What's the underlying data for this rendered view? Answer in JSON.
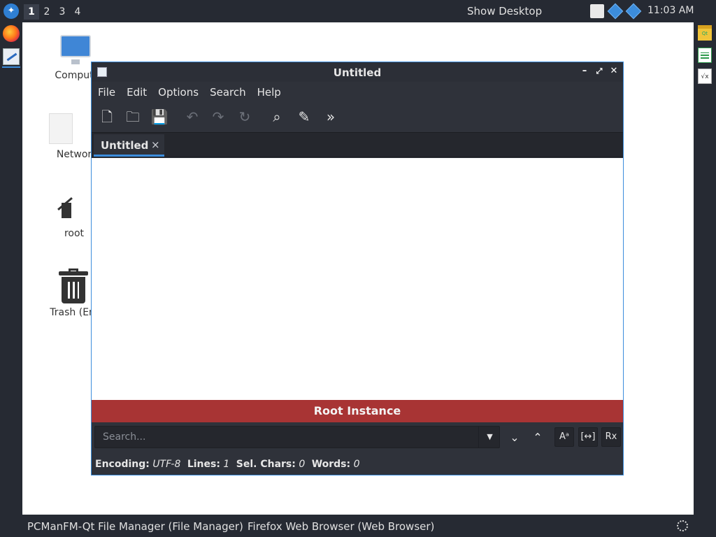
{
  "top_panel": {
    "menu_icon": "lxqt-logo-icon",
    "workspaces": [
      "1",
      "2",
      "3",
      "4"
    ],
    "active_workspace": "1",
    "show_desktop": "Show Desktop",
    "tray_icons": [
      "clipboard-icon",
      "network-diamond-icon",
      "network-diamond-icon"
    ],
    "clock": "11:03 AM"
  },
  "left_dock": {
    "items": [
      "firefox-icon",
      "featherpad-icon"
    ]
  },
  "right_dock": {
    "items": [
      "qt-designer-icon",
      "spreadsheet-icon",
      "math-formula-icon"
    ],
    "qt_label": "Qt",
    "math_label": "√x"
  },
  "desktop": {
    "icons": [
      {
        "label": "Comput",
        "icon": "computer-icon"
      },
      {
        "label": "Networ",
        "icon": "network-file-icon"
      },
      {
        "label": "root",
        "icon": "home-folder-icon"
      },
      {
        "label": "Trash (Em",
        "icon": "trash-icon"
      }
    ]
  },
  "window": {
    "title": "Untitled",
    "controls": {
      "minimize": "–",
      "maximize": "⤢",
      "close": "✕"
    },
    "menu": [
      "File",
      "Edit",
      "Options",
      "Search",
      "Help"
    ],
    "toolbar": [
      {
        "name": "new-document-icon",
        "glyph": "🗋",
        "enabled": true
      },
      {
        "name": "open-folder-icon",
        "glyph": "🗀",
        "enabled": true
      },
      {
        "name": "save-icon",
        "glyph": "💾",
        "enabled": false
      },
      {
        "name": "undo-icon",
        "glyph": "↶",
        "enabled": false
      },
      {
        "name": "redo-icon",
        "glyph": "↷",
        "enabled": false
      },
      {
        "name": "reload-icon",
        "glyph": "↻",
        "enabled": false
      },
      {
        "name": "find-icon",
        "glyph": "⌕",
        "enabled": true
      },
      {
        "name": "clear-search-icon",
        "glyph": "✎",
        "enabled": true
      },
      {
        "name": "more-actions-icon",
        "glyph": "»",
        "enabled": true
      }
    ],
    "tab": {
      "label": "Untitled",
      "close": "×"
    },
    "root_banner": "Root Instance",
    "search": {
      "placeholder": "Search...",
      "dropdown_glyph": "▼",
      "down_glyph": "⌄",
      "up_glyph": "⌃",
      "match_case": "Aᵃ",
      "whole_word": "[↔]",
      "regex": "Rx"
    },
    "status": {
      "encoding_label": "Encoding:",
      "encoding": "UTF-8",
      "lines_label": "Lines:",
      "lines": "1",
      "sel_label": "Sel. Chars:",
      "sel": "0",
      "words_label": "Words:",
      "words": "0"
    }
  },
  "bottom_panel": {
    "tasks": [
      "PCManFM-Qt File Manager (File Manager)",
      "Firefox Web Browser (Web Browser)"
    ],
    "tray_icon": "settings-dots-icon"
  }
}
